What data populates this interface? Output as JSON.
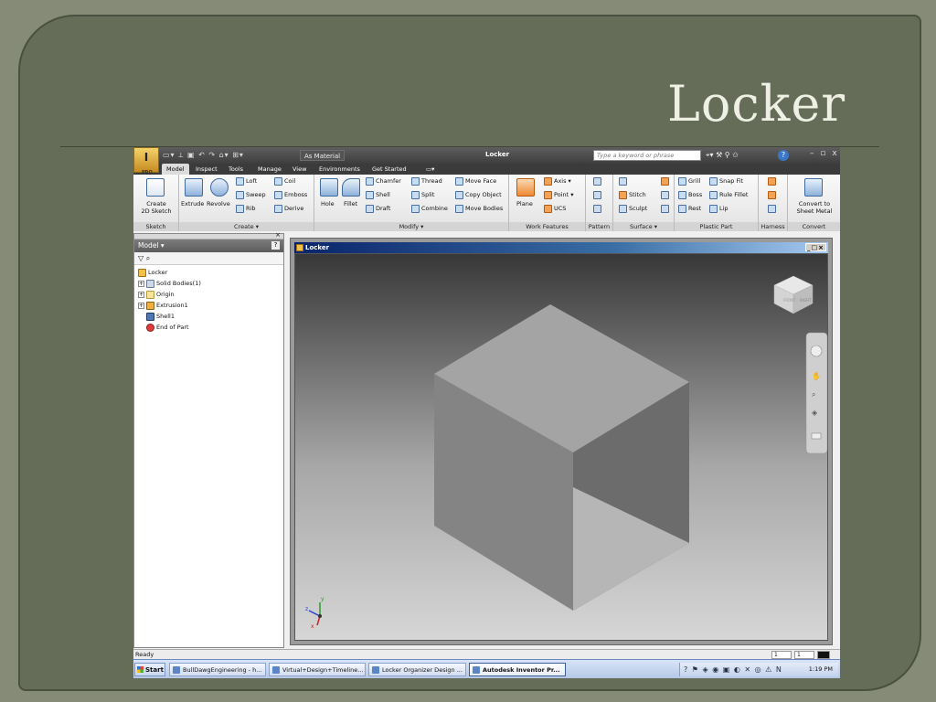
{
  "slide": {
    "title": "Locker"
  },
  "app": {
    "app_button": "I",
    "app_button_sub": "PRO",
    "qat_icons": "▭▾ ⟂ ▣ ↶ ↷ ⌂▾ ⊞▾",
    "material": "As Material",
    "document_title": "Locker",
    "search_placeholder": "Type a keyword or phrase",
    "toolbar_icons": "⌖▾ ⚒ ⚲ ✩",
    "help": "?",
    "window_controls": "– ▫ x"
  },
  "tabs": [
    "Model",
    "Inspect",
    "Tools",
    "Manage",
    "View",
    "Environments",
    "Get Started",
    "▭▾"
  ],
  "ribbon": {
    "sketch": {
      "create_sketch": "Create",
      "create_sketch_2": "2D Sketch",
      "label": "Sketch"
    },
    "create": {
      "extrude": "Extrude",
      "revolve": "Revolve",
      "loft": "Loft",
      "sweep": "Sweep",
      "rib": "Rib",
      "coil": "Coil",
      "emboss": "Emboss",
      "derive": "Derive",
      "label": "Create ▾"
    },
    "modify": {
      "hole": "Hole",
      "fillet": "Fillet",
      "chamfer": "Chamfer",
      "shell": "Shell",
      "draft": "Draft",
      "thread": "Thread",
      "split": "Split",
      "combine": "Combine",
      "move_face": "Move Face",
      "copy_object": "Copy Object",
      "move_bodies": "Move Bodies",
      "label": "Modify ▾"
    },
    "work_features": {
      "plane": "Plane",
      "axis": "Axis ▾",
      "point": "Point ▾",
      "ucs": "UCS",
      "label": "Work Features"
    },
    "pattern": {
      "label": "Pattern"
    },
    "surface": {
      "stitch": "Stitch",
      "sculpt": "Sculpt",
      "label": "Surface ▾"
    },
    "plastic_part": {
      "grill": "Grill",
      "boss": "Boss",
      "rest": "Rest",
      "snap_fit": "Snap Fit",
      "rule_fillet": "Rule Fillet",
      "lip": "Lip",
      "label": "Plastic Part"
    },
    "harness": {
      "label": "Harness"
    },
    "convert": {
      "convert_1": "Convert to",
      "convert_2": "Sheet Metal",
      "label": "Convert"
    }
  },
  "browser": {
    "pin": "×",
    "title": "Model ▾",
    "help": "?",
    "tools": "▽  ⌕",
    "nodes": [
      {
        "label": "Locker",
        "expander": ""
      },
      {
        "label": "Solid Bodies(1)",
        "expander": "+"
      },
      {
        "label": "Origin",
        "expander": "+"
      },
      {
        "label": "Extrusion1",
        "expander": "+"
      },
      {
        "label": "Shell1",
        "expander": ""
      },
      {
        "label": "End of Part",
        "expander": ""
      }
    ]
  },
  "graphics_window": {
    "title": "Locker",
    "controls": "_□×",
    "view_cube_labels": [
      "FRONT",
      "RIGHT"
    ],
    "triad": {
      "x": "x",
      "y": "y",
      "z": "z"
    }
  },
  "status": {
    "text": "Ready",
    "box1": "1",
    "box2": "1"
  },
  "taskbar": {
    "start": "Start",
    "buttons": [
      {
        "label": "BullDawgEngineering - h...",
        "active": false
      },
      {
        "label": "Virtual+Design+Timeline...",
        "active": false
      },
      {
        "label": "Locker Organizer Design ...",
        "active": false
      },
      {
        "label": "Autodesk Inventor Pr...",
        "active": true
      }
    ],
    "tray_icons": "? ⚑ ◈ ◉ ▣ ◐ ✕ ◎ ⚠ N",
    "time": "1:19 PM"
  },
  "colors": {
    "slide_bg": "#656c58",
    "cube_top": "#a4a4a4",
    "cube_left": "#848484",
    "cube_right": "#6c6c6c",
    "accent_blue": "#0a246a"
  }
}
